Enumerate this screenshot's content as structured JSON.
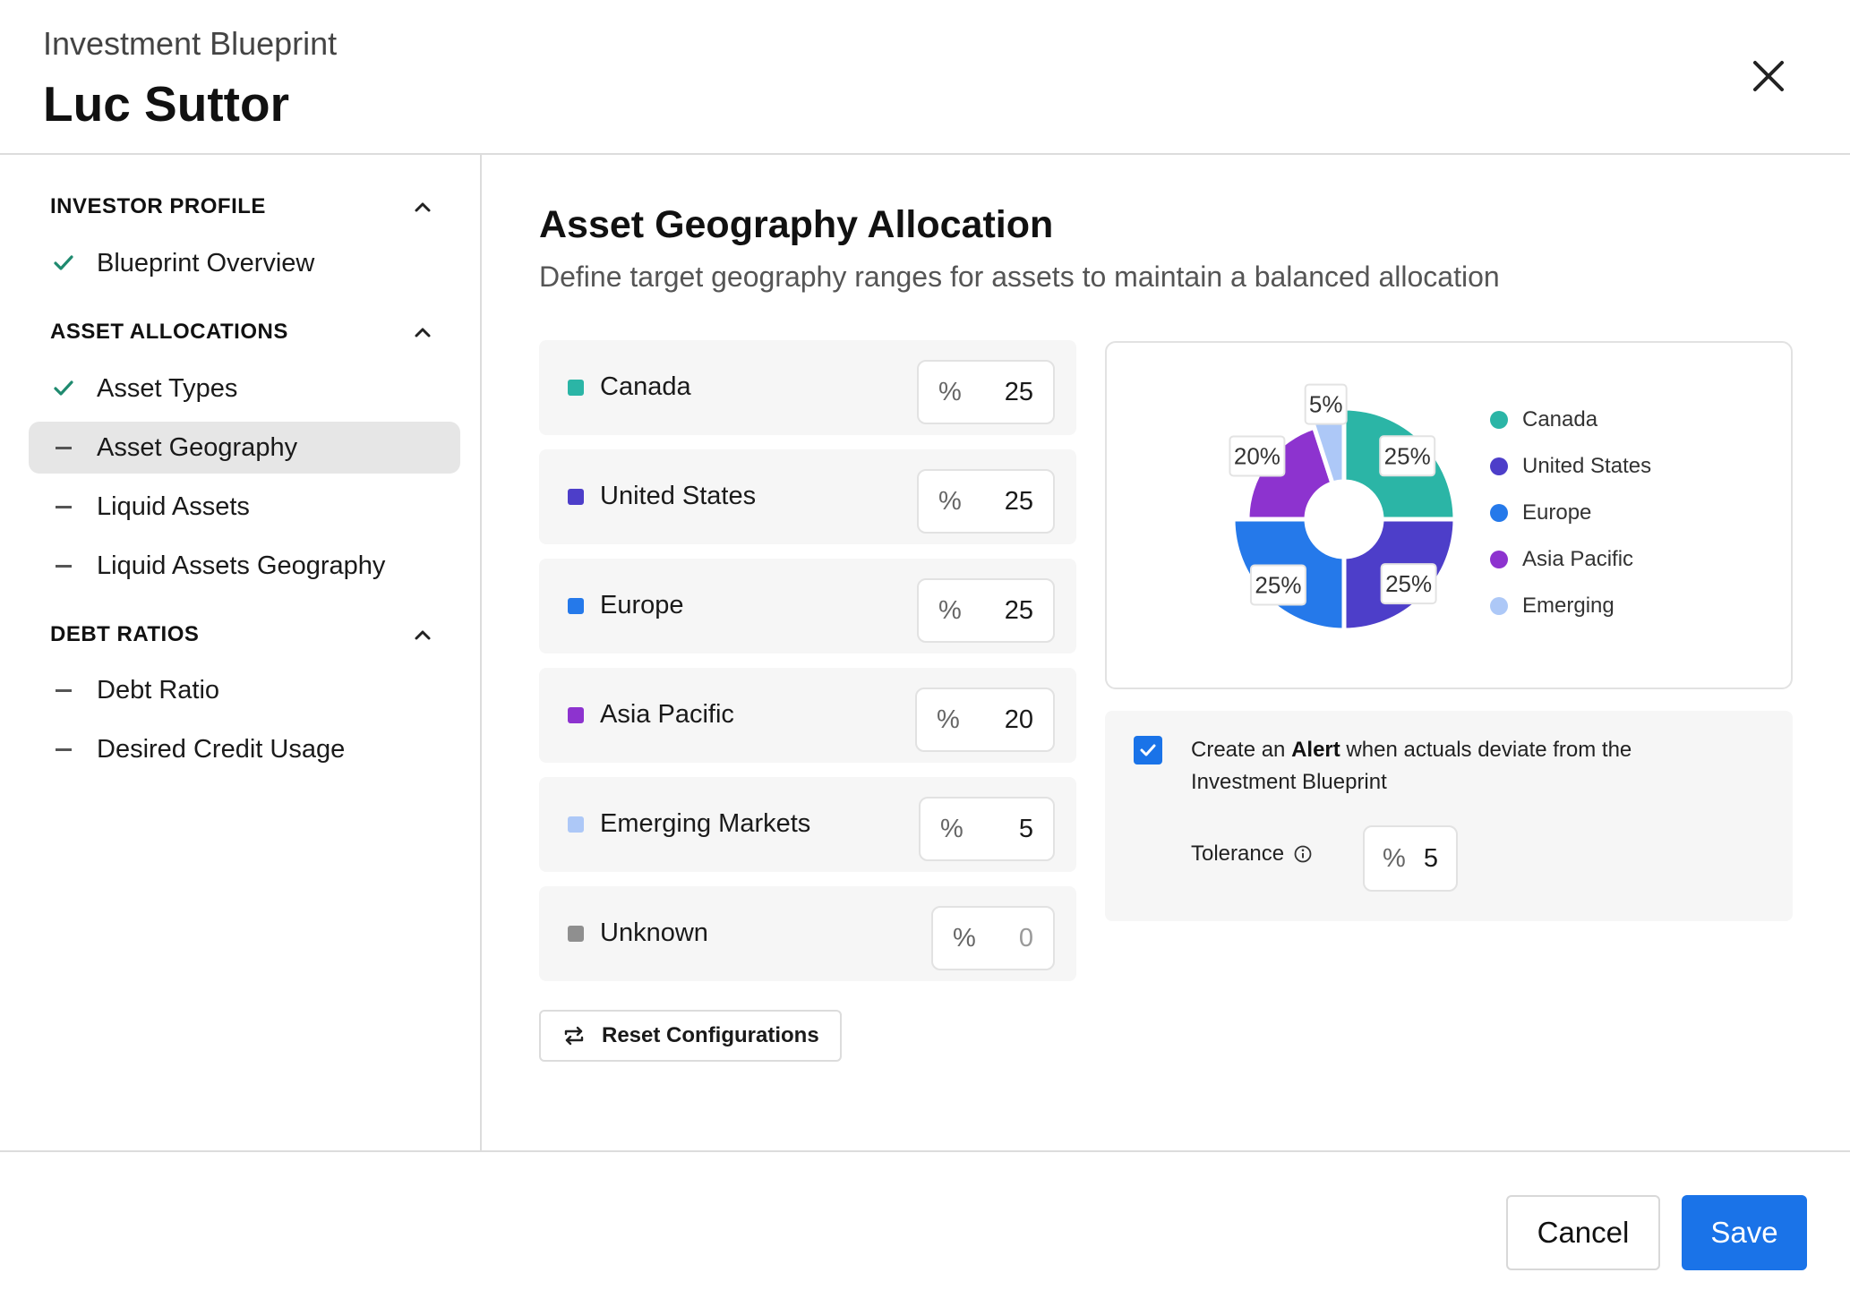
{
  "header": {
    "subtitle": "Investment Blueprint",
    "name": "Luc Suttor",
    "close_icon": "close-icon"
  },
  "sidebar": {
    "sections": [
      {
        "title": "INVESTOR PROFILE",
        "items": [
          {
            "label": "Blueprint Overview",
            "status": "complete"
          }
        ]
      },
      {
        "title": "ASSET ALLOCATIONS",
        "items": [
          {
            "label": "Asset Types",
            "status": "complete"
          },
          {
            "label": "Asset Geography",
            "status": "active"
          },
          {
            "label": "Liquid Assets",
            "status": "pending"
          },
          {
            "label": "Liquid Assets Geography",
            "status": "pending"
          }
        ]
      },
      {
        "title": "DEBT RATIOS",
        "items": [
          {
            "label": "Debt Ratio",
            "status": "pending"
          },
          {
            "label": "Desired Credit Usage",
            "status": "pending"
          }
        ]
      }
    ]
  },
  "main": {
    "title": "Asset Geography Allocation",
    "description": "Define target geography ranges for assets to maintain a balanced allocation",
    "rows": [
      {
        "name": "Canada",
        "symbol": "%",
        "value": "25",
        "color": "#2bb5a6"
      },
      {
        "name": "United States",
        "symbol": "%",
        "value": "25",
        "color": "#4d3ec9"
      },
      {
        "name": "Europe",
        "symbol": "%",
        "value": "25",
        "color": "#2579ea"
      },
      {
        "name": "Asia Pacific",
        "symbol": "%",
        "value": "20",
        "color": "#8d33cf"
      },
      {
        "name": "Emerging Markets",
        "symbol": "%",
        "value": "5",
        "color": "#adc8f7"
      },
      {
        "name": "Unknown",
        "symbol": "%",
        "value": "0",
        "color": "#8f8f8f"
      }
    ],
    "reset_label": "Reset Configurations"
  },
  "chart_data": {
    "type": "pie",
    "categories": [
      "Canada",
      "United States",
      "Europe",
      "Asia Pacific",
      "Emerging"
    ],
    "values": [
      25,
      25,
      25,
      20,
      5
    ],
    "data_labels": [
      "25%",
      "25%",
      "25%",
      "20%",
      "5%"
    ],
    "colors": [
      "#2bb5a6",
      "#4d3ec9",
      "#2579ea",
      "#8d33cf",
      "#adc8f7"
    ],
    "legend": [
      "Canada",
      "United States",
      "Europe",
      "Asia Pacific",
      "Emerging"
    ],
    "legend_position": "right"
  },
  "alert": {
    "checked": true,
    "text_before": "Create an ",
    "text_bold": "Alert",
    "text_after": " when actuals deviate from the Investment Blueprint",
    "tolerance_label": "Tolerance",
    "tolerance_symbol": "%",
    "tolerance_value": "5"
  },
  "footer": {
    "cancel_label": "Cancel",
    "save_label": "Save"
  }
}
